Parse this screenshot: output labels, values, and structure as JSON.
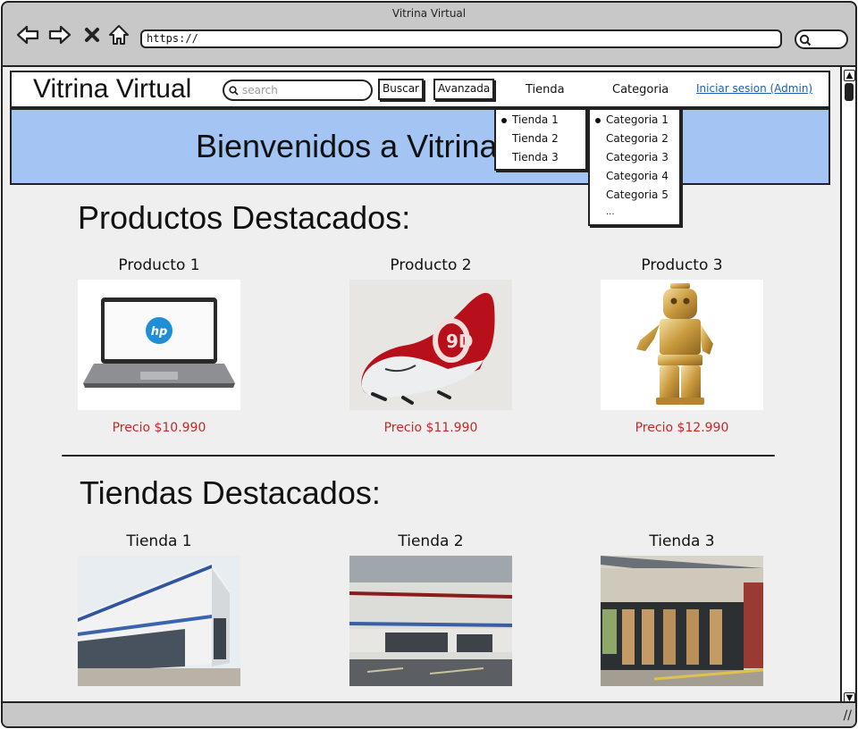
{
  "window": {
    "title": "Vitrina Virtual",
    "url": "https://"
  },
  "header": {
    "brand": "Vitrina Virtual",
    "search_placeholder": "search",
    "buscar_label": "Buscar",
    "avanzada_label": "Avanzada",
    "tienda_menu": "Tienda",
    "categoria_menu": "Categoria",
    "admin_link": "Iniciar sesion (Admin)"
  },
  "banner": {
    "text": "Bienvenidos a Vitrina Virtual"
  },
  "tienda_dropdown": [
    "Tienda 1",
    "Tienda 2",
    "Tienda 3"
  ],
  "categoria_dropdown": [
    "Categoria 1",
    "Categoria 2",
    "Categoria 3",
    "Categoria 4",
    "Categoria 5",
    "..."
  ],
  "productos": {
    "heading": "Productos Destacados:",
    "items": [
      {
        "name": "Producto 1",
        "price": "Precio $10.990"
      },
      {
        "name": "Producto 2",
        "price": "Precio $11.990"
      },
      {
        "name": "Producto 3",
        "price": "Precio $12.990"
      }
    ]
  },
  "tiendas": {
    "heading": "Tiendas Destacados:",
    "items": [
      {
        "name": "Tienda 1"
      },
      {
        "name": "Tienda 2"
      },
      {
        "name": "Tienda 3"
      }
    ]
  },
  "colors": {
    "banner": "#a4c5f4",
    "price": "#c62828",
    "link": "#1a5fb4"
  }
}
